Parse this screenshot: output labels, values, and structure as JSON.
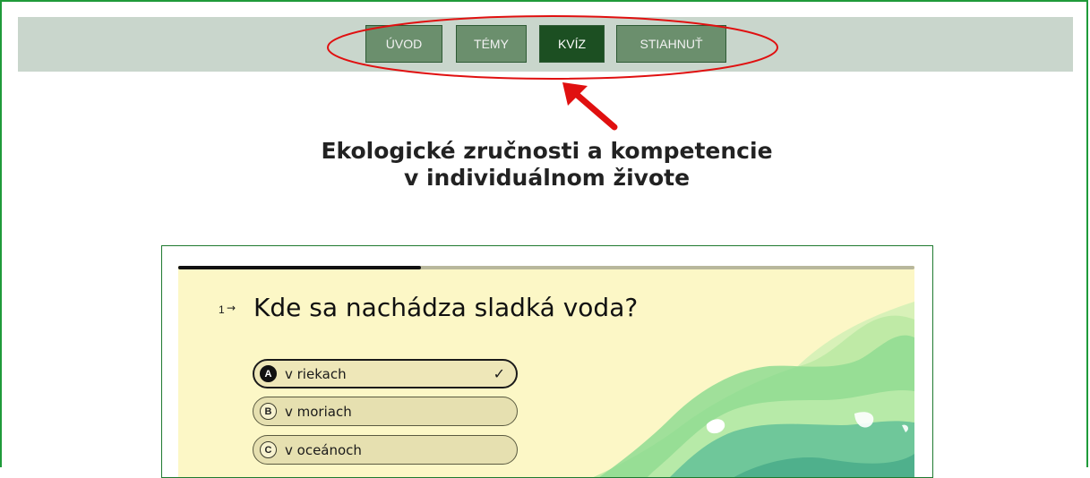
{
  "nav": {
    "items": [
      {
        "label": "ÚVOD",
        "active": false
      },
      {
        "label": "TÉMY",
        "active": false
      },
      {
        "label": "KVÍZ",
        "active": true
      },
      {
        "label": "STIAHNUŤ",
        "active": false
      }
    ]
  },
  "page": {
    "title_line1": "Ekologické zručnosti a kompetencie",
    "title_line2": "v individuálnom živote"
  },
  "quiz": {
    "progress": 0.33,
    "question_number": "1",
    "question_arrow": "→",
    "question_text": "Kde sa nachádza sladká voda?",
    "options": [
      {
        "key": "A",
        "label": "v riekach",
        "selected": true,
        "mark": "✓"
      },
      {
        "key": "B",
        "label": "v moriach",
        "selected": false,
        "mark": ""
      },
      {
        "key": "C",
        "label": "v oceánoch",
        "selected": false,
        "mark": ""
      }
    ]
  },
  "colors": {
    "frame_border": "#1f9a3a",
    "nav_bar_bg": "#c9d6cc",
    "nav_button_bg": "#6b8f6d",
    "nav_button_active_bg": "#1c4f22",
    "annotation_red": "#e01010",
    "quiz_bg": "#fcf7c6"
  }
}
